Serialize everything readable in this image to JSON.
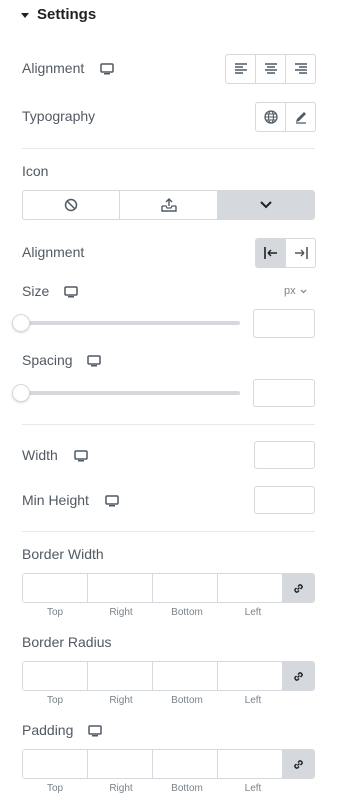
{
  "settings": {
    "title": "Settings"
  },
  "text_alignment": {
    "label": "Alignment"
  },
  "typography": {
    "label": "Typography"
  },
  "icon": {
    "label": "Icon"
  },
  "icon_alignment": {
    "label": "Alignment"
  },
  "size": {
    "label": "Size",
    "unit": "px",
    "value": 0
  },
  "spacing": {
    "label": "Spacing",
    "value": 0
  },
  "width": {
    "label": "Width"
  },
  "min_height": {
    "label": "Min Height"
  },
  "border_width": {
    "label": "Border Width",
    "sides": [
      "Top",
      "Right",
      "Bottom",
      "Left"
    ]
  },
  "border_radius": {
    "label": "Border Radius",
    "sides": [
      "Top",
      "Right",
      "Bottom",
      "Left"
    ]
  },
  "padding": {
    "label": "Padding",
    "sides": [
      "Top",
      "Right",
      "Bottom",
      "Left"
    ]
  },
  "colors": {
    "accent_gray": "#d5d8dc",
    "text": "#515962",
    "heading": "#1f2124"
  }
}
